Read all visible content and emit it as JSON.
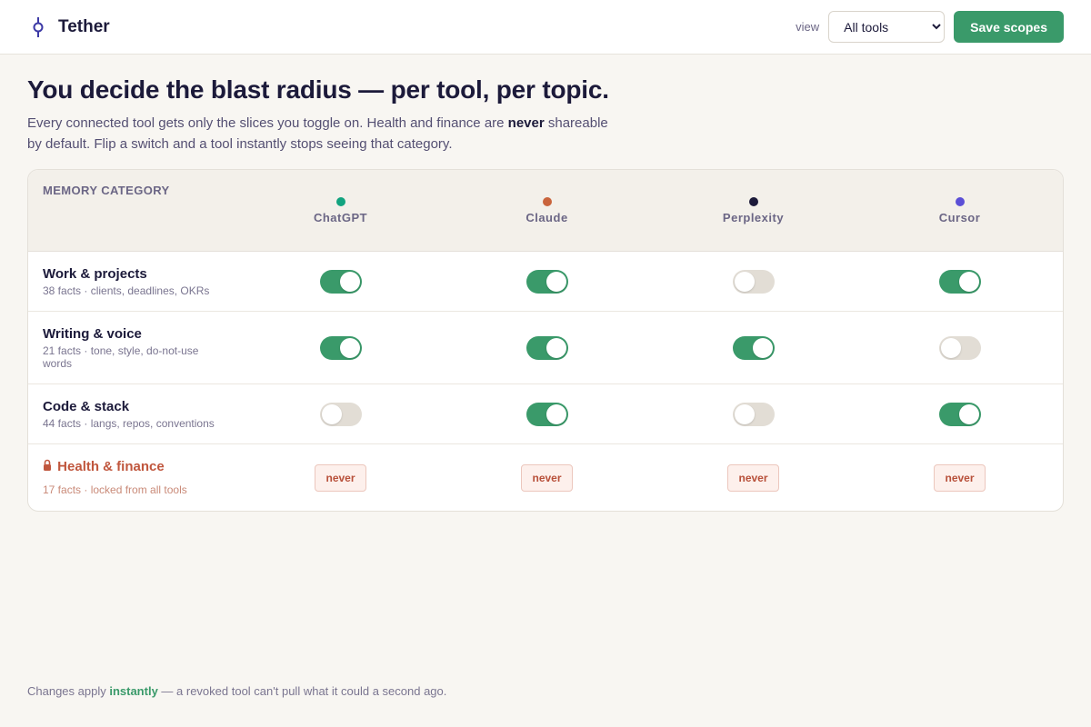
{
  "app": {
    "name": "Tether"
  },
  "header": {
    "view_label": "view",
    "view_options": [
      "All tools"
    ],
    "view_selected": "All tools",
    "save_label": "Save scopes"
  },
  "hero": {
    "title": "You decide the blast radius — per tool, per topic.",
    "desc_part1": "Every connected tool gets only the slices you toggle on. Health and finance are ",
    "desc_bold": "never",
    "desc_part2": " shareable by default. Flip a switch and a tool instantly stops seeing that category."
  },
  "table": {
    "category_header": "MEMORY CATEGORY",
    "tools": [
      {
        "name": "ChatGPT",
        "color": "#12a37f"
      },
      {
        "name": "Claude",
        "color": "#c9643c"
      },
      {
        "name": "Perplexity",
        "color": "#1c1a3a"
      },
      {
        "name": "Cursor",
        "color": "#5b4fd6"
      }
    ],
    "rows": [
      {
        "title": "Work & projects",
        "subtitle": "38 facts · clients, deadlines, OKRs",
        "access": [
          true,
          true,
          false,
          true
        ]
      },
      {
        "title": "Writing & voice",
        "subtitle": "21 facts · tone, style, do-not-use words",
        "access": [
          true,
          true,
          true,
          false
        ]
      },
      {
        "title": "Code & stack",
        "subtitle": "44 facts · langs, repos, conventions",
        "access": [
          false,
          true,
          false,
          true
        ]
      }
    ],
    "sensitive_row": {
      "title": "Health & finance",
      "subtitle": "17 facts · locked from all tools",
      "badge": "never"
    }
  },
  "footer": {
    "part1": "Changes apply ",
    "bold": "instantly",
    "part2": " — a revoked tool can't pull what it could a second ago."
  },
  "colors": {
    "accent": "#3a9a6a",
    "danger": "#c0563d",
    "background": "#f8f6f2"
  }
}
